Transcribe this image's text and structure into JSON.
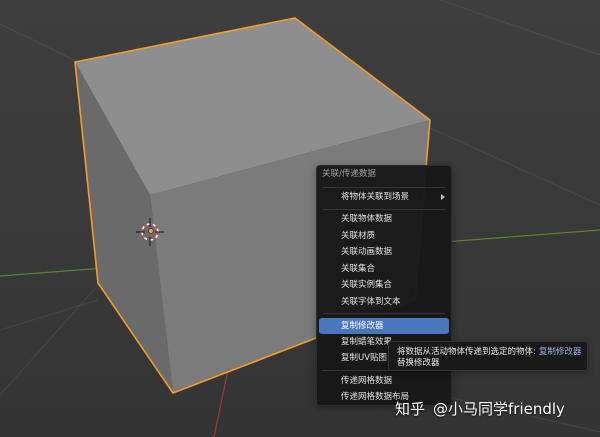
{
  "theme": {
    "selection_outline": "#f29c2b",
    "menu_highlight": "#4a76bf",
    "x_axis": "#9e3a3a",
    "y_axis": "#5f8430",
    "tooltip_accent": "#9ab3e8"
  },
  "icons": {
    "cursor": "3d-cursor-icon",
    "origin": "origin-dot-icon",
    "submenu": "triangle-right-icon"
  },
  "menu": {
    "title": "关联/传递数据",
    "items": [
      {
        "label": "将物体关联到场景",
        "submenu": true
      },
      {
        "label": "关联物体数据"
      },
      {
        "label": "关联材质"
      },
      {
        "label": "关联动画数据"
      },
      {
        "label": "关联集合"
      },
      {
        "label": "关联实例集合"
      },
      {
        "label": "关联字体到文本"
      },
      {
        "label": "复制修改器",
        "highlighted": true
      },
      {
        "label": "复制蜡笔效果"
      },
      {
        "label": "复制UV贴图"
      },
      {
        "label": "传递网格数据"
      },
      {
        "label": "传递网格数据布局"
      }
    ]
  },
  "tooltip": {
    "description": "将数据从活动物体传递到选定的物体:",
    "operator": "复制修改器",
    "detail": "替换修改器"
  },
  "watermark": {
    "site": "知乎",
    "author": "@小马同学friendly"
  }
}
